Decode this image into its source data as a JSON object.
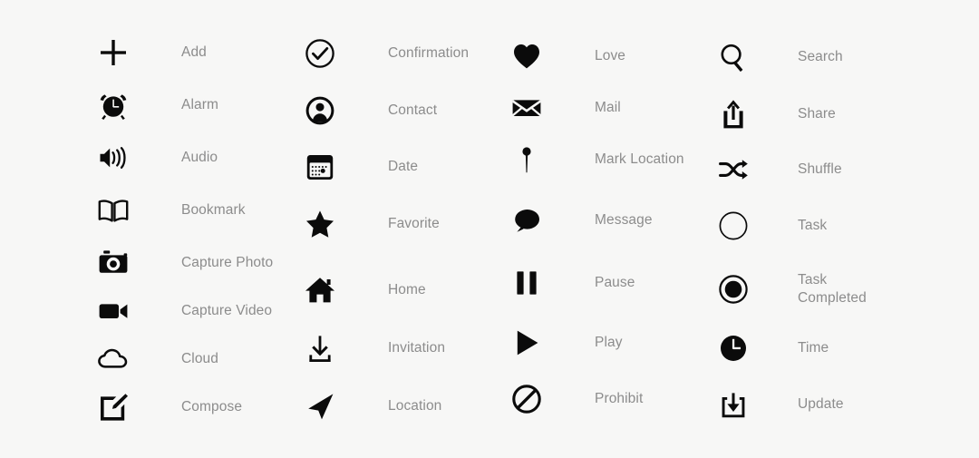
{
  "sheet": {
    "background_color": "#f7f7f6",
    "icon_color": "#0b0b0b",
    "label_color": "#8c8c8c"
  },
  "columns": [
    {
      "id": "column-1",
      "items": [
        {
          "icon": "plus-icon",
          "label": "Add"
        },
        {
          "icon": "alarm-clock-icon",
          "label": "Alarm"
        },
        {
          "icon": "speaker-audio-icon",
          "label": "Audio"
        },
        {
          "icon": "open-book-icon",
          "label": "Bookmark"
        },
        {
          "icon": "camera-icon",
          "label": "Capture Photo"
        },
        {
          "icon": "video-camera-icon",
          "label": "Capture Video"
        },
        {
          "icon": "cloud-icon",
          "label": "Cloud"
        },
        {
          "icon": "compose-pencil-icon",
          "label": "Compose"
        }
      ]
    },
    {
      "id": "column-2",
      "items": [
        {
          "icon": "check-circle-icon",
          "label": "Confirmation"
        },
        {
          "icon": "person-circle-icon",
          "label": "Contact"
        },
        {
          "icon": "calendar-icon",
          "label": "Date"
        },
        {
          "icon": "star-icon",
          "label": "Favorite"
        },
        {
          "icon": "house-icon",
          "label": "Home"
        },
        {
          "icon": "download-arrow-icon",
          "label": "Invitation"
        },
        {
          "icon": "navigation-arrow-icon",
          "label": "Location"
        }
      ]
    },
    {
      "id": "column-3",
      "items": [
        {
          "icon": "heart-icon",
          "label": "Love"
        },
        {
          "icon": "envelope-icon",
          "label": "Mail"
        },
        {
          "icon": "map-pin-icon",
          "label": "Mark Location"
        },
        {
          "icon": "speech-bubble-icon",
          "label": "Message"
        },
        {
          "icon": "pause-icon",
          "label": "Pause"
        },
        {
          "icon": "play-icon",
          "label": "Play"
        },
        {
          "icon": "prohibit-icon",
          "label": "Prohibit"
        }
      ]
    },
    {
      "id": "column-4",
      "items": [
        {
          "icon": "magnifier-icon",
          "label": "Search"
        },
        {
          "icon": "share-arrow-icon",
          "label": "Share"
        },
        {
          "icon": "shuffle-icon",
          "label": "Shuffle"
        },
        {
          "icon": "empty-circle-icon",
          "label": "Task"
        },
        {
          "icon": "filled-circle-ring-icon",
          "label": "Task\nCompleted"
        },
        {
          "icon": "clock-icon",
          "label": "Time"
        },
        {
          "icon": "update-download-box-icon",
          "label": "Update"
        }
      ]
    }
  ]
}
